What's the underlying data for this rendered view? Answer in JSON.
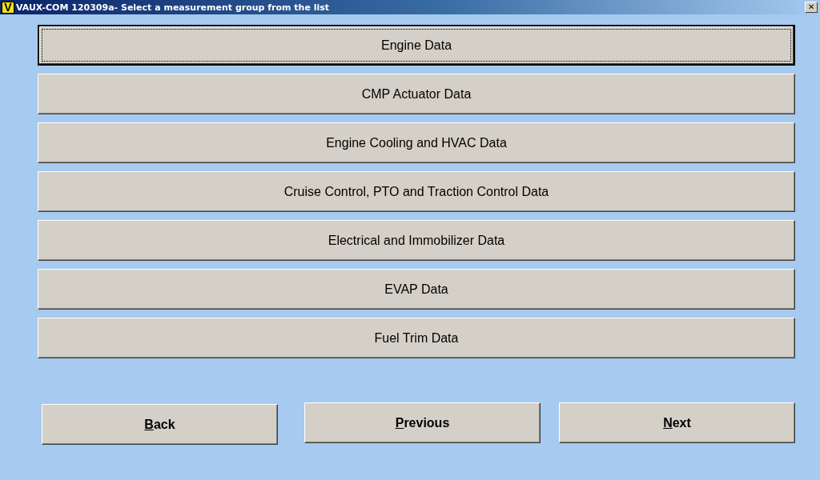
{
  "window": {
    "logo": "V",
    "title": "VAUX-COM 120309a-  Select a measurement group from the list",
    "close": "✕"
  },
  "groups": [
    {
      "label": "Engine Data",
      "selected": true
    },
    {
      "label": "CMP Actuator Data",
      "selected": false
    },
    {
      "label": "Engine Cooling and HVAC Data",
      "selected": false
    },
    {
      "label": "Cruise Control, PTO and Traction Control Data",
      "selected": false
    },
    {
      "label": "Electrical and Immobilizer Data",
      "selected": false
    },
    {
      "label": "EVAP Data",
      "selected": false
    },
    {
      "label": "Fuel Trim Data",
      "selected": false
    }
  ],
  "nav_buttons": [
    {
      "label": "Back",
      "underline_first": true
    },
    {
      "label": "Previous",
      "underline_first": true
    },
    {
      "label": "Next",
      "underline_first": true
    }
  ]
}
